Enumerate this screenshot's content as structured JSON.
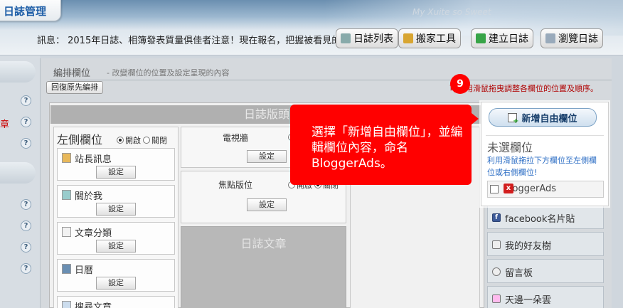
{
  "header": {
    "app_title": "日誌管理",
    "watermark": "My Xuite so Sweet",
    "notice": "訊息： 2015年日誌、相簿發表質量俱佳者注意！現在報名，把握被看見的機會",
    "buttons": [
      {
        "label": "日誌列表",
        "icon": "list-icon"
      },
      {
        "label": "搬家工具",
        "icon": "truck-icon"
      },
      {
        "label": "建立日誌",
        "icon": "plus-icon"
      },
      {
        "label": "瀏覽日誌",
        "icon": "magnifier-icon"
      }
    ]
  },
  "leftnav": {
    "help_glyph": "?",
    "truncated_label": "章"
  },
  "section": {
    "title": "編排欄位",
    "description": "- 改變欄位的位置及設定呈現的內容",
    "restore_label": "回復原先編排",
    "drag_hint": "可利用滑鼠拖曳調整各欄位的位置及順序。"
  },
  "layout": {
    "header_bar": "日誌版頭",
    "left_col": {
      "title": "左側欄位",
      "radio_on": "開啟",
      "radio_off": "關閉",
      "modules": [
        {
          "name": "站長訊息",
          "button": "設定"
        },
        {
          "name": "關於我",
          "button": "設定"
        },
        {
          "name": "文章分類",
          "button": "設定"
        },
        {
          "name": "日曆",
          "button": "設定"
        },
        {
          "name": "搜尋文章",
          "button": ""
        }
      ]
    },
    "mid_col": {
      "tv_wall": {
        "name": "電視牆",
        "button": "設定"
      },
      "focus": {
        "name": "焦點版位",
        "button": "設定",
        "radio_on": "開啟",
        "radio_off": "關閉"
      },
      "article": "日誌文章"
    }
  },
  "sidebar_list": [
    {
      "name": "facebook名片貼",
      "icon": "facebook-icon"
    },
    {
      "name": "我的好友樹",
      "icon": "tree-icon"
    },
    {
      "name": "留言板",
      "icon": "chat-icon"
    },
    {
      "name": "天邊一朵雲",
      "icon": "cloud-icon"
    }
  ],
  "unselected": {
    "add_button": "新增自由欄位",
    "title": "未選欄位",
    "description": "利用滑鼠拖拉下方欄位至左側欄位或右側欄位!",
    "item": {
      "name": "BloggerAds",
      "delete_glyph": "x"
    }
  },
  "callout": {
    "step": "9",
    "text": "選擇「新增自由欄位」，並編輯欄位內容，命名BloggerAds。"
  }
}
